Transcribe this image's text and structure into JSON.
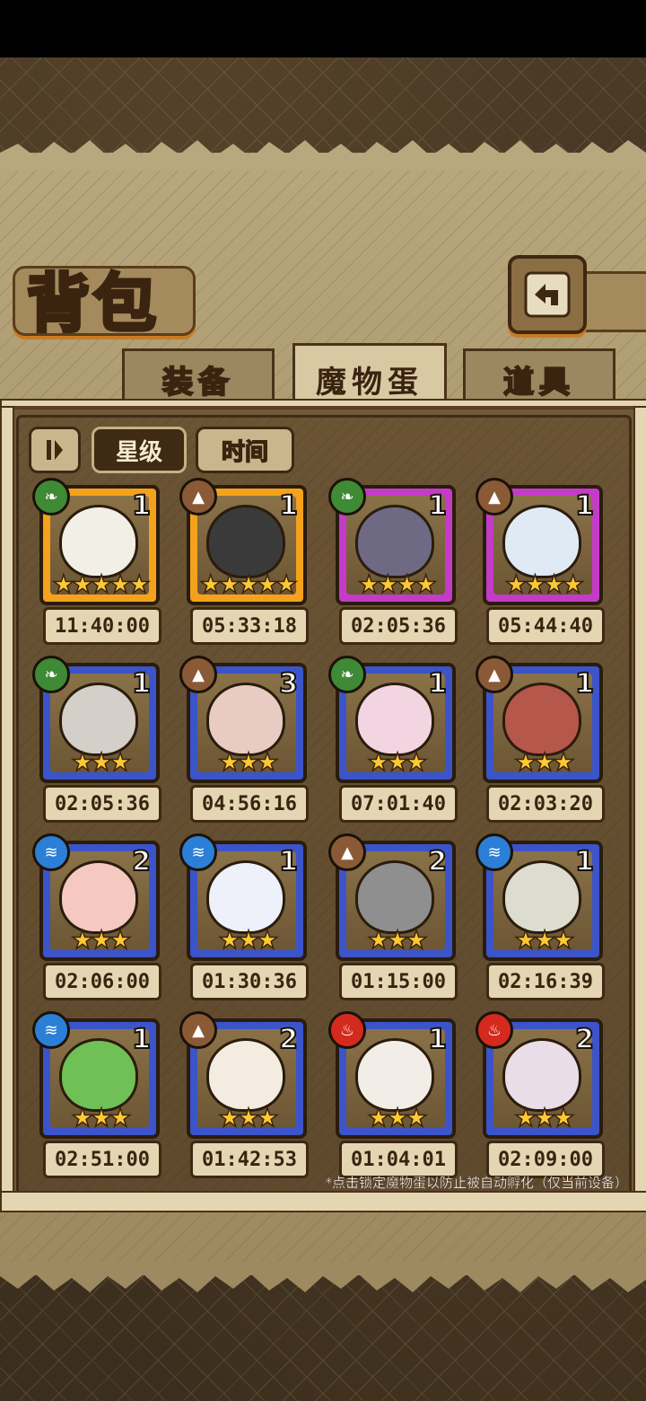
{
  "screen_title": "背包",
  "tabs": [
    {
      "label": "装备",
      "active": false
    },
    {
      "label": "魔物蛋",
      "active": true
    },
    {
      "label": "道具",
      "active": false
    }
  ],
  "sort": {
    "toggle_icon": "pause-sort-icon",
    "options": [
      {
        "label": "星级",
        "active": true
      },
      {
        "label": "时间",
        "active": false
      }
    ]
  },
  "colors": {
    "gold": "#f4a21c",
    "purple": "#c43bc8",
    "blue": "#3b54c9",
    "nature": "#3f8a34",
    "earth": "#8a5a36",
    "water": "#2b7fd6",
    "fire": "#d42a1e"
  },
  "eggs": [
    {
      "count": "1",
      "stars": "★★★★★",
      "time": "11:40:00",
      "element": "nature",
      "rarity": "gold",
      "egg_color": "#f2efe6"
    },
    {
      "count": "1",
      "stars": "★★★★★",
      "time": "05:33:18",
      "element": "earth",
      "rarity": "gold",
      "egg_color": "#3a3a3a"
    },
    {
      "count": "1",
      "stars": "★★★★",
      "time": "02:05:36",
      "element": "nature",
      "rarity": "purple",
      "egg_color": "#6e6a84"
    },
    {
      "count": "1",
      "stars": "★★★★",
      "time": "05:44:40",
      "element": "earth",
      "rarity": "purple",
      "egg_color": "#dfeaf5"
    },
    {
      "count": "1",
      "stars": "★★★",
      "time": "02:05:36",
      "element": "nature",
      "rarity": "blue",
      "egg_color": "#d4cfc8"
    },
    {
      "count": "3",
      "stars": "★★★",
      "time": "04:56:16",
      "element": "earth",
      "rarity": "blue",
      "egg_color": "#e8ccc4"
    },
    {
      "count": "1",
      "stars": "★★★",
      "time": "07:01:40",
      "element": "nature",
      "rarity": "blue",
      "egg_color": "#f3d5e2"
    },
    {
      "count": "1",
      "stars": "★★★",
      "time": "02:03:20",
      "element": "earth",
      "rarity": "blue",
      "egg_color": "#b5574a"
    },
    {
      "count": "2",
      "stars": "★★★",
      "time": "02:06:00",
      "element": "water",
      "rarity": "blue",
      "egg_color": "#f5c8c0"
    },
    {
      "count": "1",
      "stars": "★★★",
      "time": "01:30:36",
      "element": "water",
      "rarity": "blue",
      "egg_color": "#eef0fa"
    },
    {
      "count": "2",
      "stars": "★★★",
      "time": "01:15:00",
      "element": "earth",
      "rarity": "blue",
      "egg_color": "#8f8f8f"
    },
    {
      "count": "1",
      "stars": "★★★",
      "time": "02:16:39",
      "element": "water",
      "rarity": "blue",
      "egg_color": "#dcdccf"
    },
    {
      "count": "1",
      "stars": "★★★",
      "time": "02:51:00",
      "element": "water",
      "rarity": "blue",
      "egg_color": "#6fc057"
    },
    {
      "count": "2",
      "stars": "★★★",
      "time": "01:42:53",
      "element": "earth",
      "rarity": "blue",
      "egg_color": "#f4ece0"
    },
    {
      "count": "1",
      "stars": "★★★",
      "time": "01:04:01",
      "element": "fire",
      "rarity": "blue",
      "egg_color": "#f2ede6"
    },
    {
      "count": "2",
      "stars": "★★★",
      "time": "02:09:00",
      "element": "fire",
      "rarity": "blue",
      "egg_color": "#e9dde8"
    }
  ],
  "hint": "*点击锁定魔物蛋以防止被自动孵化（仅当前设备）"
}
